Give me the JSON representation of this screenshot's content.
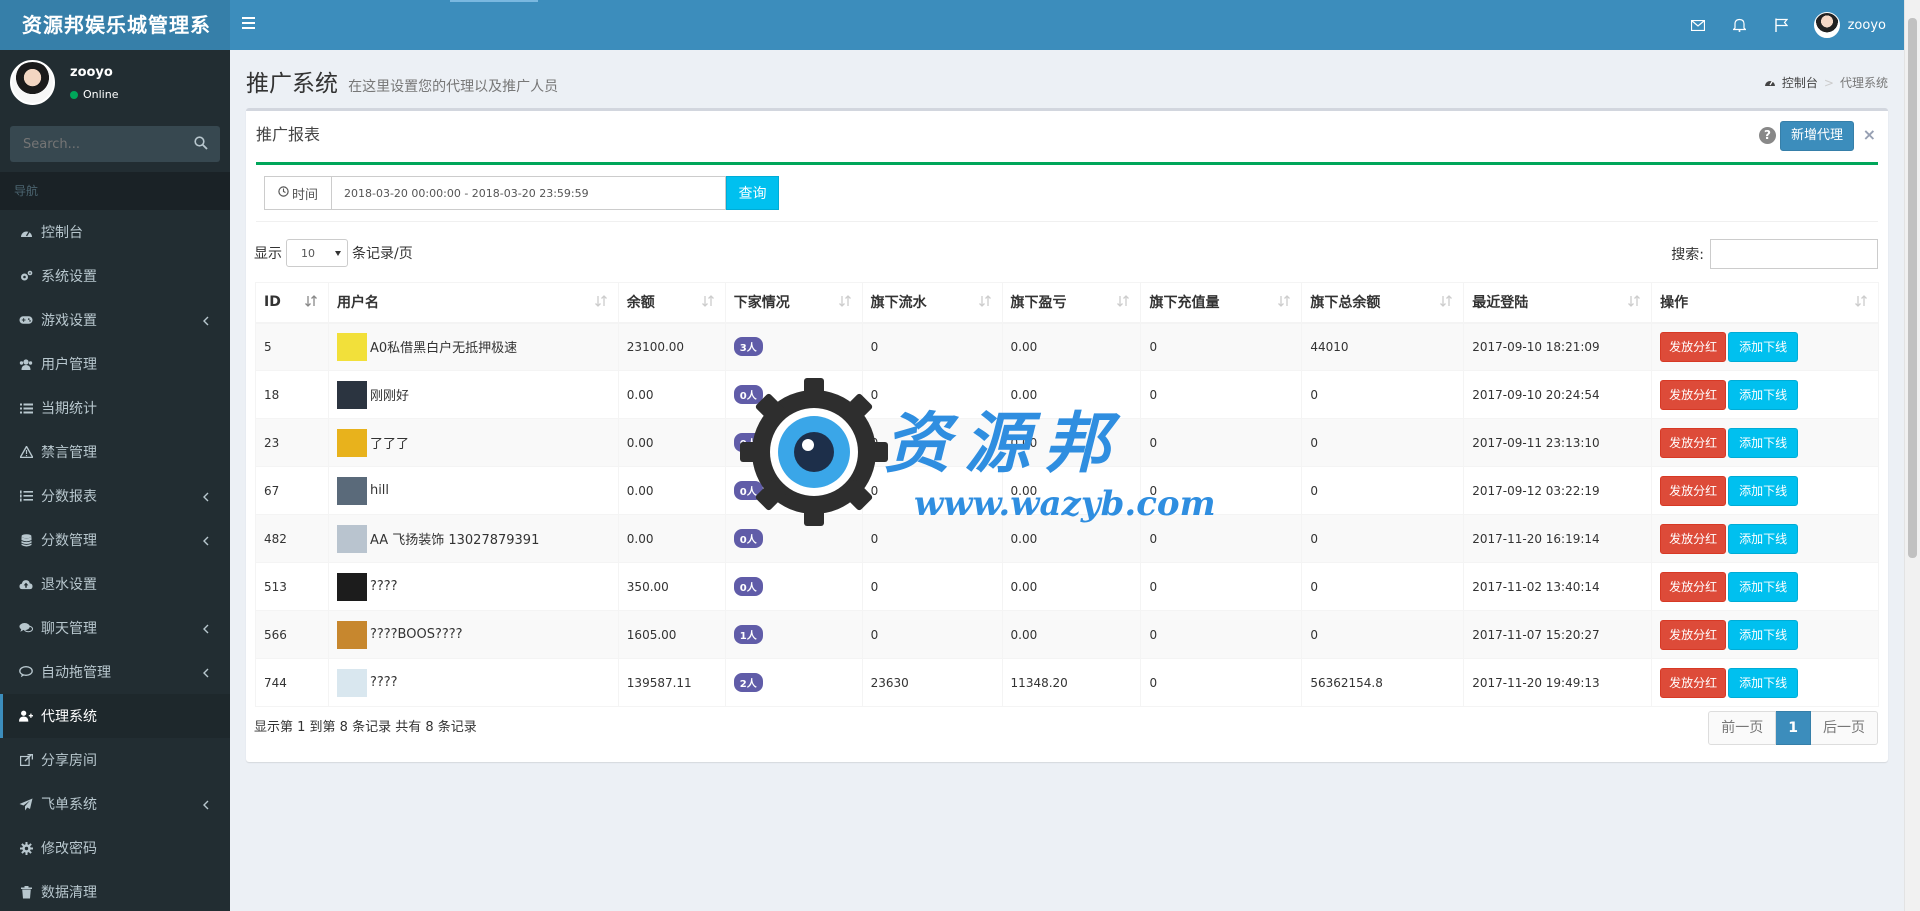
{
  "app": {
    "title": "资源邦娱乐城管理系",
    "user": "zooyo"
  },
  "sidebar": {
    "user_name": "zooyo",
    "user_status": "Online",
    "search_placeholder": "Search...",
    "nav_header": "导航",
    "items": [
      {
        "label": "控制台",
        "icon": "dashboard-icon",
        "submenu": false
      },
      {
        "label": "系统设置",
        "icon": "cogs-icon",
        "submenu": false
      },
      {
        "label": "游戏设置",
        "icon": "gamepad-icon",
        "submenu": true
      },
      {
        "label": "用户管理",
        "icon": "users-icon",
        "submenu": false
      },
      {
        "label": "当期统计",
        "icon": "list-icon",
        "submenu": false
      },
      {
        "label": "禁言管理",
        "icon": "warning-icon",
        "submenu": false
      },
      {
        "label": "分数报表",
        "icon": "list-ol-icon",
        "submenu": true
      },
      {
        "label": "分数管理",
        "icon": "database-icon",
        "submenu": true
      },
      {
        "label": "退水设置",
        "icon": "cloud-upload-icon",
        "submenu": false
      },
      {
        "label": "聊天管理",
        "icon": "comments-icon",
        "submenu": true
      },
      {
        "label": "自动拖管理",
        "icon": "comment-icon",
        "submenu": true
      },
      {
        "label": "代理系统",
        "icon": "user-plus-icon",
        "submenu": false,
        "active": true
      },
      {
        "label": "分享房间",
        "icon": "share-icon",
        "submenu": false
      },
      {
        "label": "飞单系统",
        "icon": "paper-plane-icon",
        "submenu": true
      },
      {
        "label": "修改密码",
        "icon": "gear-icon",
        "submenu": false
      },
      {
        "label": "数据清理",
        "icon": "trash-icon",
        "submenu": false
      }
    ]
  },
  "header": {
    "title": "推广系统",
    "subtitle": "在这里设置您的代理以及推广人员",
    "breadcrumb": [
      "控制台",
      "代理系统"
    ]
  },
  "box": {
    "title": "推广报表",
    "add_button": "新增代理",
    "help": "?",
    "close": "×"
  },
  "filter": {
    "time_label": "时间",
    "date_range": "2018-03-20 00:00:00 - 2018-03-20 23:59:59",
    "query_button": "查询"
  },
  "table_controls": {
    "show_label": "显示",
    "page_size": "10",
    "per_page_label": "条记录/页",
    "search_label": "搜索:"
  },
  "table": {
    "columns": [
      "ID",
      "用户名",
      "余额",
      "下家情况",
      "旗下流水",
      "旗下盈亏",
      "旗下充值量",
      "旗下总余额",
      "最近登陆",
      "操作"
    ],
    "rows": [
      {
        "id": "5",
        "name": "A0私借黑白户无抵押极速",
        "thumb": "#f2e03a",
        "balance": "23100.00",
        "downline": "3人",
        "flow": "0",
        "profit": "0.00",
        "recharge": "0",
        "total": "44010",
        "last_login": "2017-09-10 18:21:09"
      },
      {
        "id": "18",
        "name": "刚刚好",
        "thumb": "#2b3440",
        "balance": "0.00",
        "downline": "0人",
        "flow": "0",
        "profit": "0.00",
        "recharge": "0",
        "total": "0",
        "last_login": "2017-09-10 20:24:54"
      },
      {
        "id": "23",
        "name": "了了了",
        "thumb": "#e8b21c",
        "balance": "0.00",
        "downline": "0人",
        "flow": "0",
        "profit": "0.00",
        "recharge": "0",
        "total": "0",
        "last_login": "2017-09-11 23:13:10"
      },
      {
        "id": "67",
        "name": "hill",
        "thumb": "#5a6a7a",
        "balance": "0.00",
        "downline": "0人",
        "flow": "0",
        "profit": "0.00",
        "recharge": "0",
        "total": "0",
        "last_login": "2017-09-12 03:22:19"
      },
      {
        "id": "482",
        "name": "AA 飞扬装饰 13027879391",
        "thumb": "#b9c4cf",
        "balance": "0.00",
        "downline": "0人",
        "flow": "0",
        "profit": "0.00",
        "recharge": "0",
        "total": "0",
        "last_login": "2017-11-20 16:19:14"
      },
      {
        "id": "513",
        "name": "????",
        "thumb": "#1c1c1c",
        "balance": "350.00",
        "downline": "0人",
        "flow": "0",
        "profit": "0.00",
        "recharge": "0",
        "total": "0",
        "last_login": "2017-11-02 13:40:14"
      },
      {
        "id": "566",
        "name": "????BOOS????",
        "thumb": "#c7872e",
        "balance": "1605.00",
        "downline": "1人",
        "flow": "0",
        "profit": "0.00",
        "recharge": "0",
        "total": "0",
        "last_login": "2017-11-07 15:20:27"
      },
      {
        "id": "744",
        "name": "????",
        "thumb": "#d9e7ef",
        "balance": "139587.11",
        "downline": "2人",
        "flow": "23630",
        "profit": "11348.20",
        "recharge": "0",
        "total": "56362154.8",
        "last_login": "2017-11-20 19:49:13"
      }
    ],
    "action_dividend": "发放分红",
    "action_add": "添加下线"
  },
  "footer": {
    "info": "显示第 1 到第 8 条记录 共有 8 条记录",
    "prev": "前一页",
    "page": "1",
    "next": "后一页"
  },
  "watermark": {
    "text": "资源邦",
    "url": "www.wazyb.com"
  }
}
